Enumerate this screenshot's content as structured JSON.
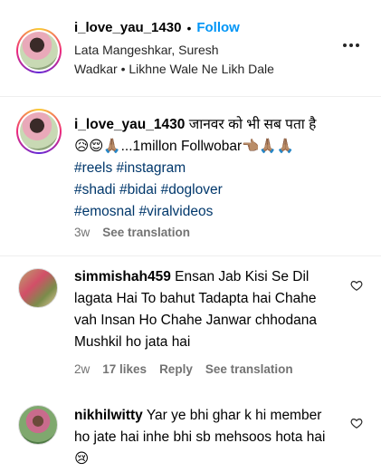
{
  "header": {
    "username": "i_love_yau_1430",
    "separator": "•",
    "follow_label": "Follow",
    "audio_line1": "Lata Mangeshkar, Suresh",
    "audio_line2": "Wadkar • Likhne Wale Ne Likh Dale"
  },
  "caption": {
    "username": "i_love_yau_1430",
    "text": "जानवर को भी सब पता है",
    "text2": "😥😌🙏🏽...1millon Follwobar👈🏽🙏🏽🙏🏽",
    "hashtags": [
      "#reels #instagram",
      "#shadi #bidai #doglover",
      "#emosnal #viralvideos"
    ],
    "time": "3w",
    "see_translation": "See translation"
  },
  "comments": [
    {
      "username": "simmishah459",
      "text": "Ensan Jab Kisi Se Dil lagata Hai To bahut Tadapta hai Chahe vah Insan Ho Chahe Janwar chhodana Mushkil ho jata hai",
      "time": "2w",
      "likes": "17 likes",
      "reply": "Reply",
      "see_translation": "See translation"
    },
    {
      "username": "nikhilwitty",
      "text": "Yar ye bhi ghar k hi member ho jate hai inhe bhi sb mehsoos hota hai 😢"
    }
  ],
  "icons": {
    "more": "more-options-icon",
    "heart": "heart-outline-icon"
  }
}
